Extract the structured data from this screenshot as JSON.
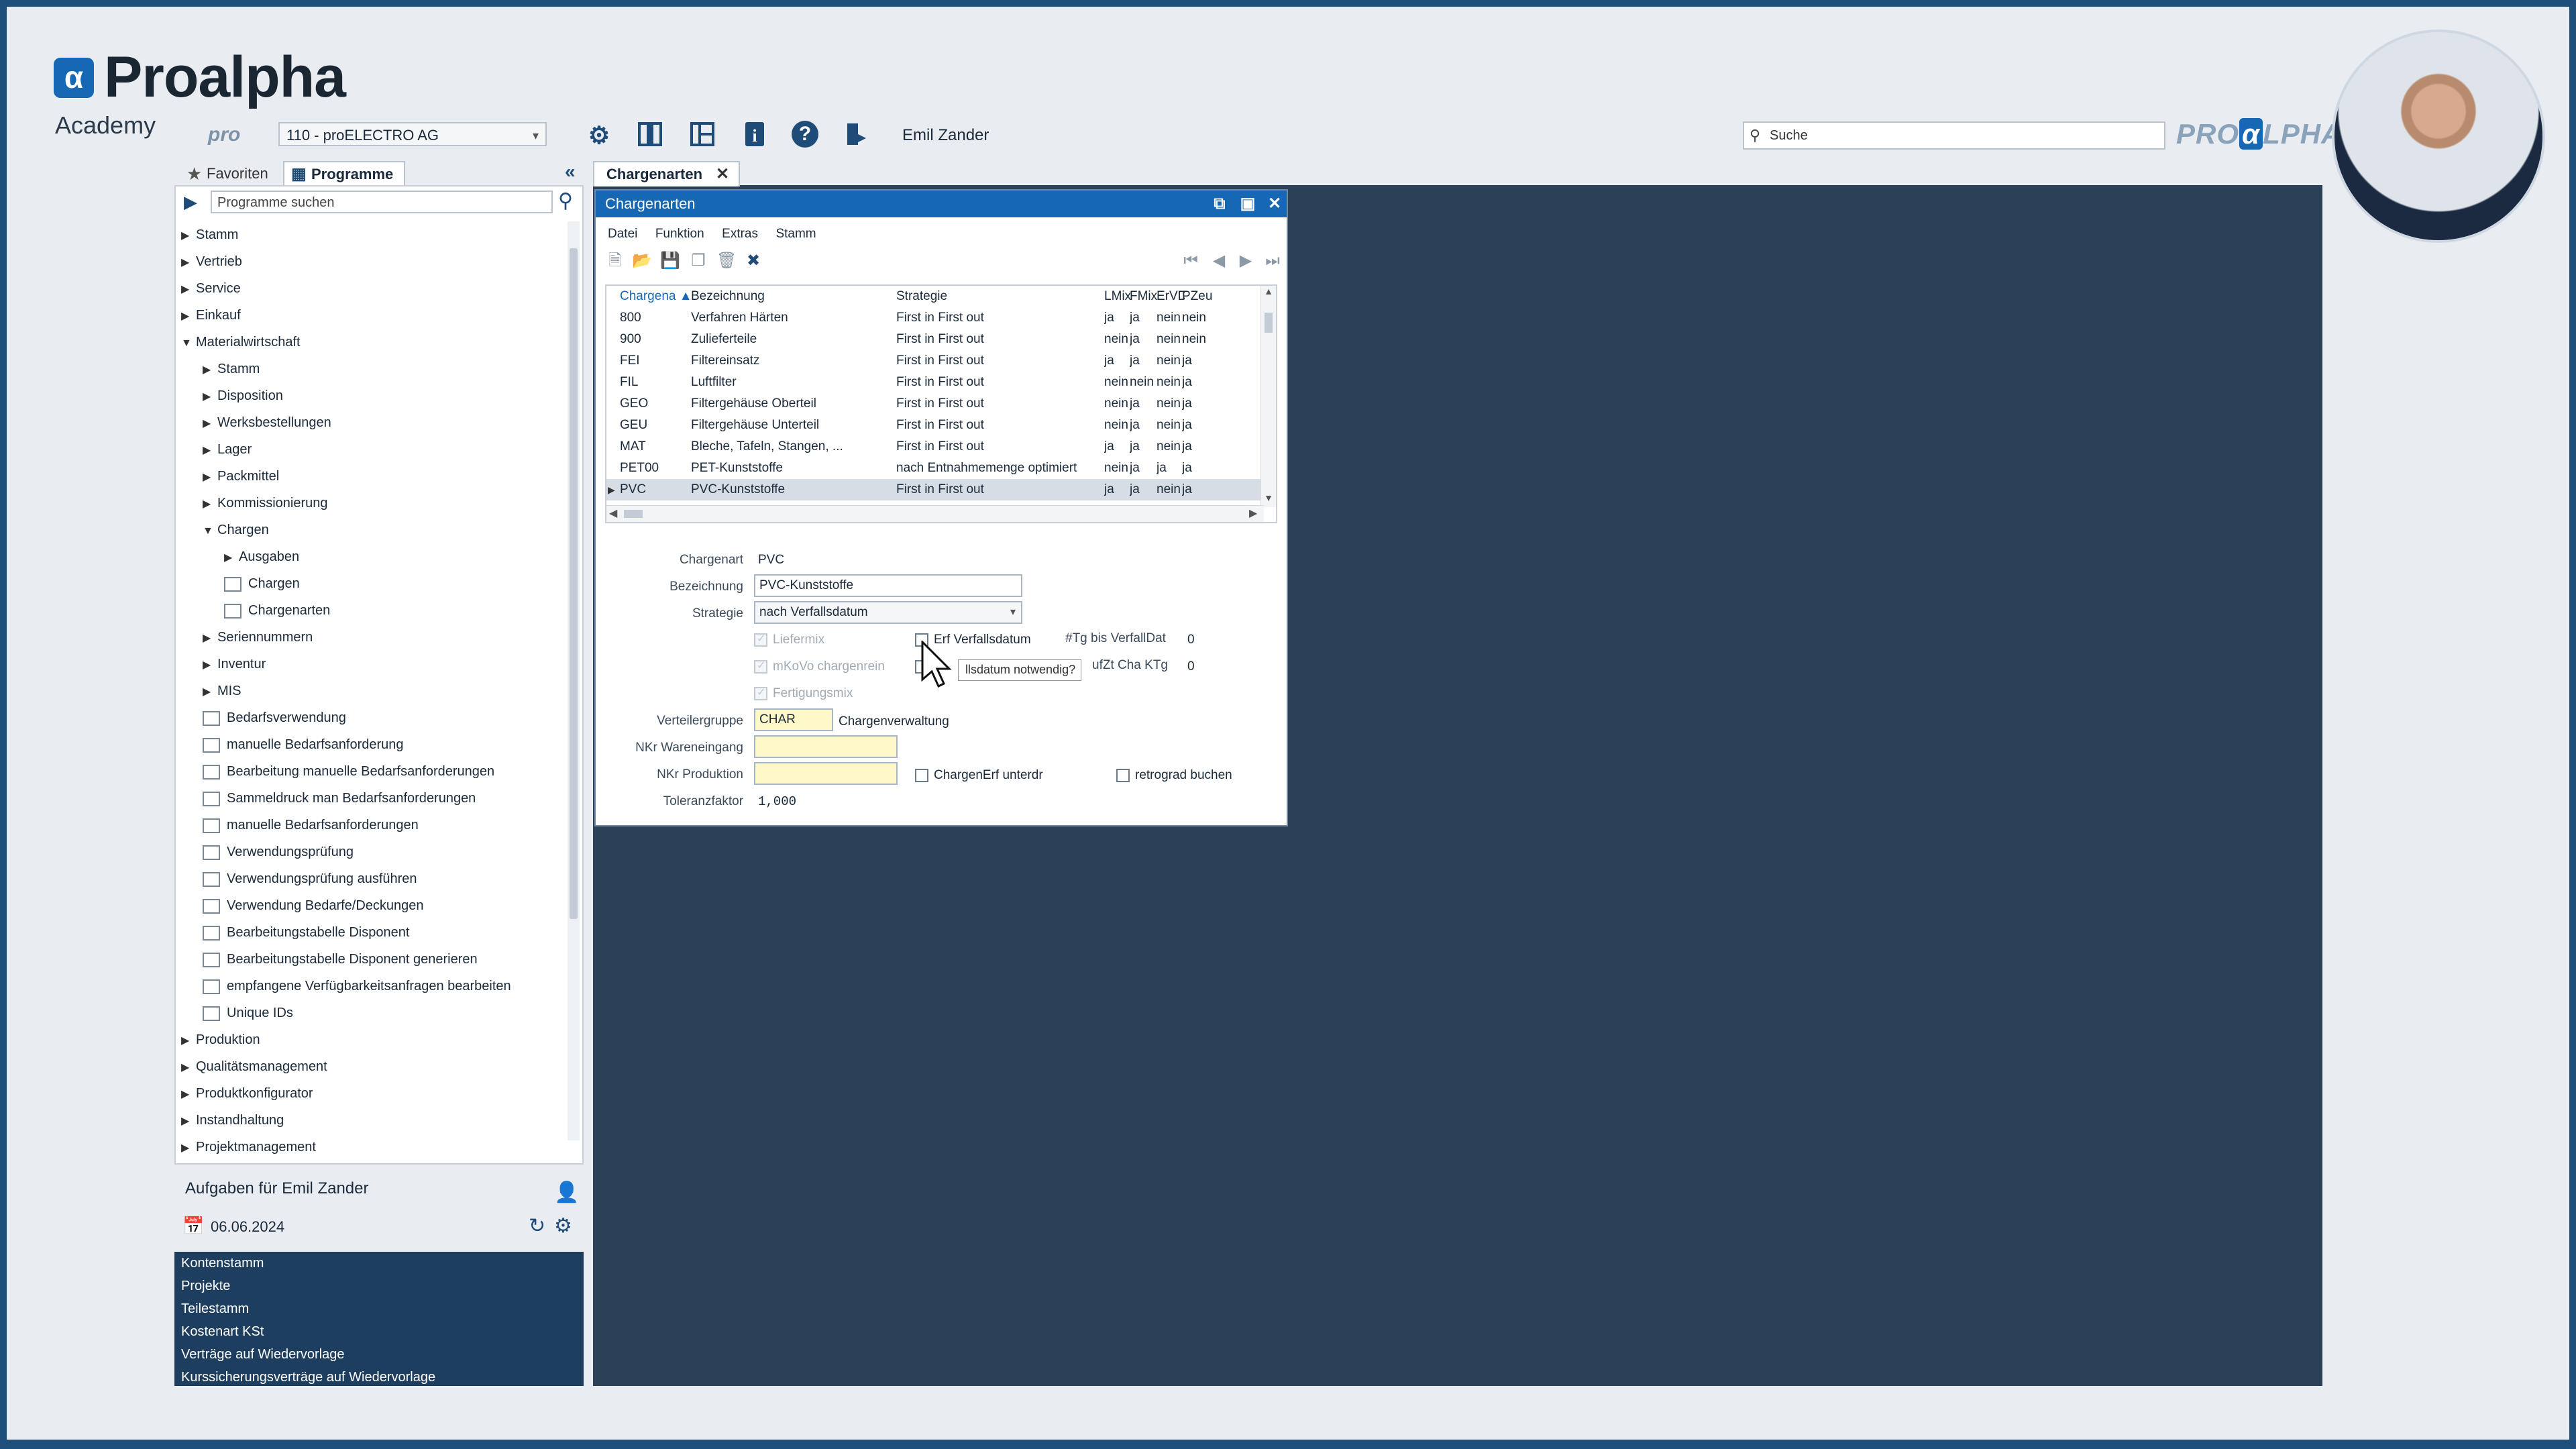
{
  "brand": {
    "name": "Proalpha",
    "sub": "Academy",
    "logo_letter": "α",
    "right_logo_a": "PRO",
    "right_logo_b": "α",
    "right_logo_c": "LPHA",
    "small_pro": "pro"
  },
  "topbar": {
    "company": "110 - proELECTRO AG",
    "user": "Emil Zander",
    "search_placeholder": "Suche",
    "icons": [
      "gear-icon",
      "layout-columns-icon",
      "layout-panels-icon",
      "info-icon",
      "help-icon",
      "exit-icon"
    ]
  },
  "left_tabs": {
    "favorites": "Favoriten",
    "programs": "Programme"
  },
  "program_search_placeholder": "Programme suchen",
  "tree": [
    {
      "label": "Stamm",
      "level": 0,
      "kind": "collapsed"
    },
    {
      "label": "Vertrieb",
      "level": 0,
      "kind": "collapsed"
    },
    {
      "label": "Service",
      "level": 0,
      "kind": "collapsed"
    },
    {
      "label": "Einkauf",
      "level": 0,
      "kind": "collapsed"
    },
    {
      "label": "Materialwirtschaft",
      "level": 0,
      "kind": "expanded"
    },
    {
      "label": "Stamm",
      "level": 1,
      "kind": "collapsed"
    },
    {
      "label": "Disposition",
      "level": 1,
      "kind": "collapsed"
    },
    {
      "label": "Werksbestellungen",
      "level": 1,
      "kind": "collapsed"
    },
    {
      "label": "Lager",
      "level": 1,
      "kind": "collapsed"
    },
    {
      "label": "Packmittel",
      "level": 1,
      "kind": "collapsed"
    },
    {
      "label": "Kommissionierung",
      "level": 1,
      "kind": "collapsed"
    },
    {
      "label": "Chargen",
      "level": 1,
      "kind": "expanded"
    },
    {
      "label": "Ausgaben",
      "level": 2,
      "kind": "collapsed"
    },
    {
      "label": "Chargen",
      "level": 2,
      "kind": "doc"
    },
    {
      "label": "Chargenarten",
      "level": 2,
      "kind": "doc"
    },
    {
      "label": "Seriennummern",
      "level": 1,
      "kind": "collapsed"
    },
    {
      "label": "Inventur",
      "level": 1,
      "kind": "collapsed"
    },
    {
      "label": "MIS",
      "level": 1,
      "kind": "collapsed"
    },
    {
      "label": "Bedarfsverwendung",
      "level": 1,
      "kind": "doc"
    },
    {
      "label": "manuelle Bedarfsanforderung",
      "level": 1,
      "kind": "doc"
    },
    {
      "label": "Bearbeitung manuelle Bedarfsanforderungen",
      "level": 1,
      "kind": "doc"
    },
    {
      "label": "Sammeldruck man Bedarfsanforderungen",
      "level": 1,
      "kind": "doc"
    },
    {
      "label": "manuelle Bedarfsanforderungen",
      "level": 1,
      "kind": "doc"
    },
    {
      "label": "Verwendungsprüfung",
      "level": 1,
      "kind": "doc"
    },
    {
      "label": "Verwendungsprüfung ausführen",
      "level": 1,
      "kind": "doc"
    },
    {
      "label": "Verwendung Bedarfe/Deckungen",
      "level": 1,
      "kind": "doc"
    },
    {
      "label": "Bearbeitungstabelle Disponent",
      "level": 1,
      "kind": "doc"
    },
    {
      "label": "Bearbeitungstabelle Disponent generieren",
      "level": 1,
      "kind": "doc"
    },
    {
      "label": "empfangene Verfügbarkeitsanfragen bearbeiten",
      "level": 1,
      "kind": "doc"
    },
    {
      "label": "Unique IDs",
      "level": 1,
      "kind": "doc"
    },
    {
      "label": "Produktion",
      "level": 0,
      "kind": "collapsed"
    },
    {
      "label": "Qualitätsmanagement",
      "level": 0,
      "kind": "collapsed"
    },
    {
      "label": "Produktkonfigurator",
      "level": 0,
      "kind": "collapsed"
    },
    {
      "label": "Instandhaltung",
      "level": 0,
      "kind": "collapsed"
    },
    {
      "label": "Projektmanagement",
      "level": 0,
      "kind": "collapsed"
    }
  ],
  "tasks": {
    "title": "Aufgaben für Emil Zander",
    "date": "06.06.2024",
    "items": [
      "Kontenstamm",
      "Projekte",
      "Teilestamm",
      "Kostenart KSt",
      "Verträge auf Wiedervorlage",
      "Kurssicherungsverträge auf Wiedervorlage"
    ]
  },
  "workspace_tab": "Chargenarten",
  "dialog": {
    "title": "Chargenarten",
    "menu": [
      "Datei",
      "Funktion",
      "Extras",
      "Stamm"
    ],
    "columns": [
      "Chargena",
      "Bezeichnung",
      "Strategie",
      "LMix",
      "FMix",
      "ErVD",
      "PZeu"
    ],
    "rows": [
      [
        "800",
        "Verfahren Härten",
        "First in First out",
        "ja",
        "ja",
        "nein",
        "nein"
      ],
      [
        "900",
        "Zulieferteile",
        "First in First out",
        "nein",
        "ja",
        "nein",
        "nein"
      ],
      [
        "FEI",
        "Filtereinsatz",
        "First in First out",
        "ja",
        "ja",
        "nein",
        "ja"
      ],
      [
        "FIL",
        "Luftfilter",
        "First in First out",
        "nein",
        "nein",
        "nein",
        "ja"
      ],
      [
        "GEO",
        "Filtergehäuse Oberteil",
        "First in First out",
        "nein",
        "ja",
        "nein",
        "ja"
      ],
      [
        "GEU",
        "Filtergehäuse Unterteil",
        "First in First out",
        "nein",
        "ja",
        "nein",
        "ja"
      ],
      [
        "MAT",
        "Bleche, Tafeln, Stangen, ...",
        "First in First out",
        "ja",
        "ja",
        "nein",
        "ja"
      ],
      [
        "PET00",
        "PET-Kunststoffe",
        "nach Entnahmemenge optimiert",
        "nein",
        "ja",
        "ja",
        "ja"
      ],
      [
        "PVC",
        "PVC-Kunststoffe",
        "First in First out",
        "ja",
        "ja",
        "nein",
        "ja"
      ]
    ],
    "selected_row": 8,
    "form": {
      "chargenart_label": "Chargenart",
      "chargenart_value": "PVC",
      "bezeichnung_label": "Bezeichnung",
      "bezeichnung_value": "PVC-Kunststoffe",
      "strategie_label": "Strategie",
      "strategie_value": "nach Verfallsdatum",
      "liefermix": "Liefermix",
      "mkovo": "mKoVo chargenrein",
      "fertigungsmix": "Fertigungsmix",
      "erf_verfallsdatum": "Erf Verfallsdatum",
      "tg_bis_verfalldat_label": "#Tg bis VerfallDat",
      "tg_bis_verfalldat_value": "0",
      "tooltip": "llsdatum notwendig?",
      "ufzt_label": "ufZt Cha KTg",
      "ufzt_value": "0",
      "verteilergruppe_label": "Verteilergruppe",
      "verteilergruppe_value": "CHAR",
      "verteilergruppe_desc": "Chargenverwaltung",
      "nkr_we_label": "NKr Wareneingang",
      "nkr_we_value": "",
      "nkr_prod_label": "NKr Produktion",
      "nkr_prod_value": "",
      "chargenerf_unterdr": "ChargenErf unterdr",
      "retrograd_buchen": "retrograd buchen",
      "toleranzfaktor_label": "Toleranzfaktor",
      "toleranzfaktor_value": "1,000"
    }
  }
}
